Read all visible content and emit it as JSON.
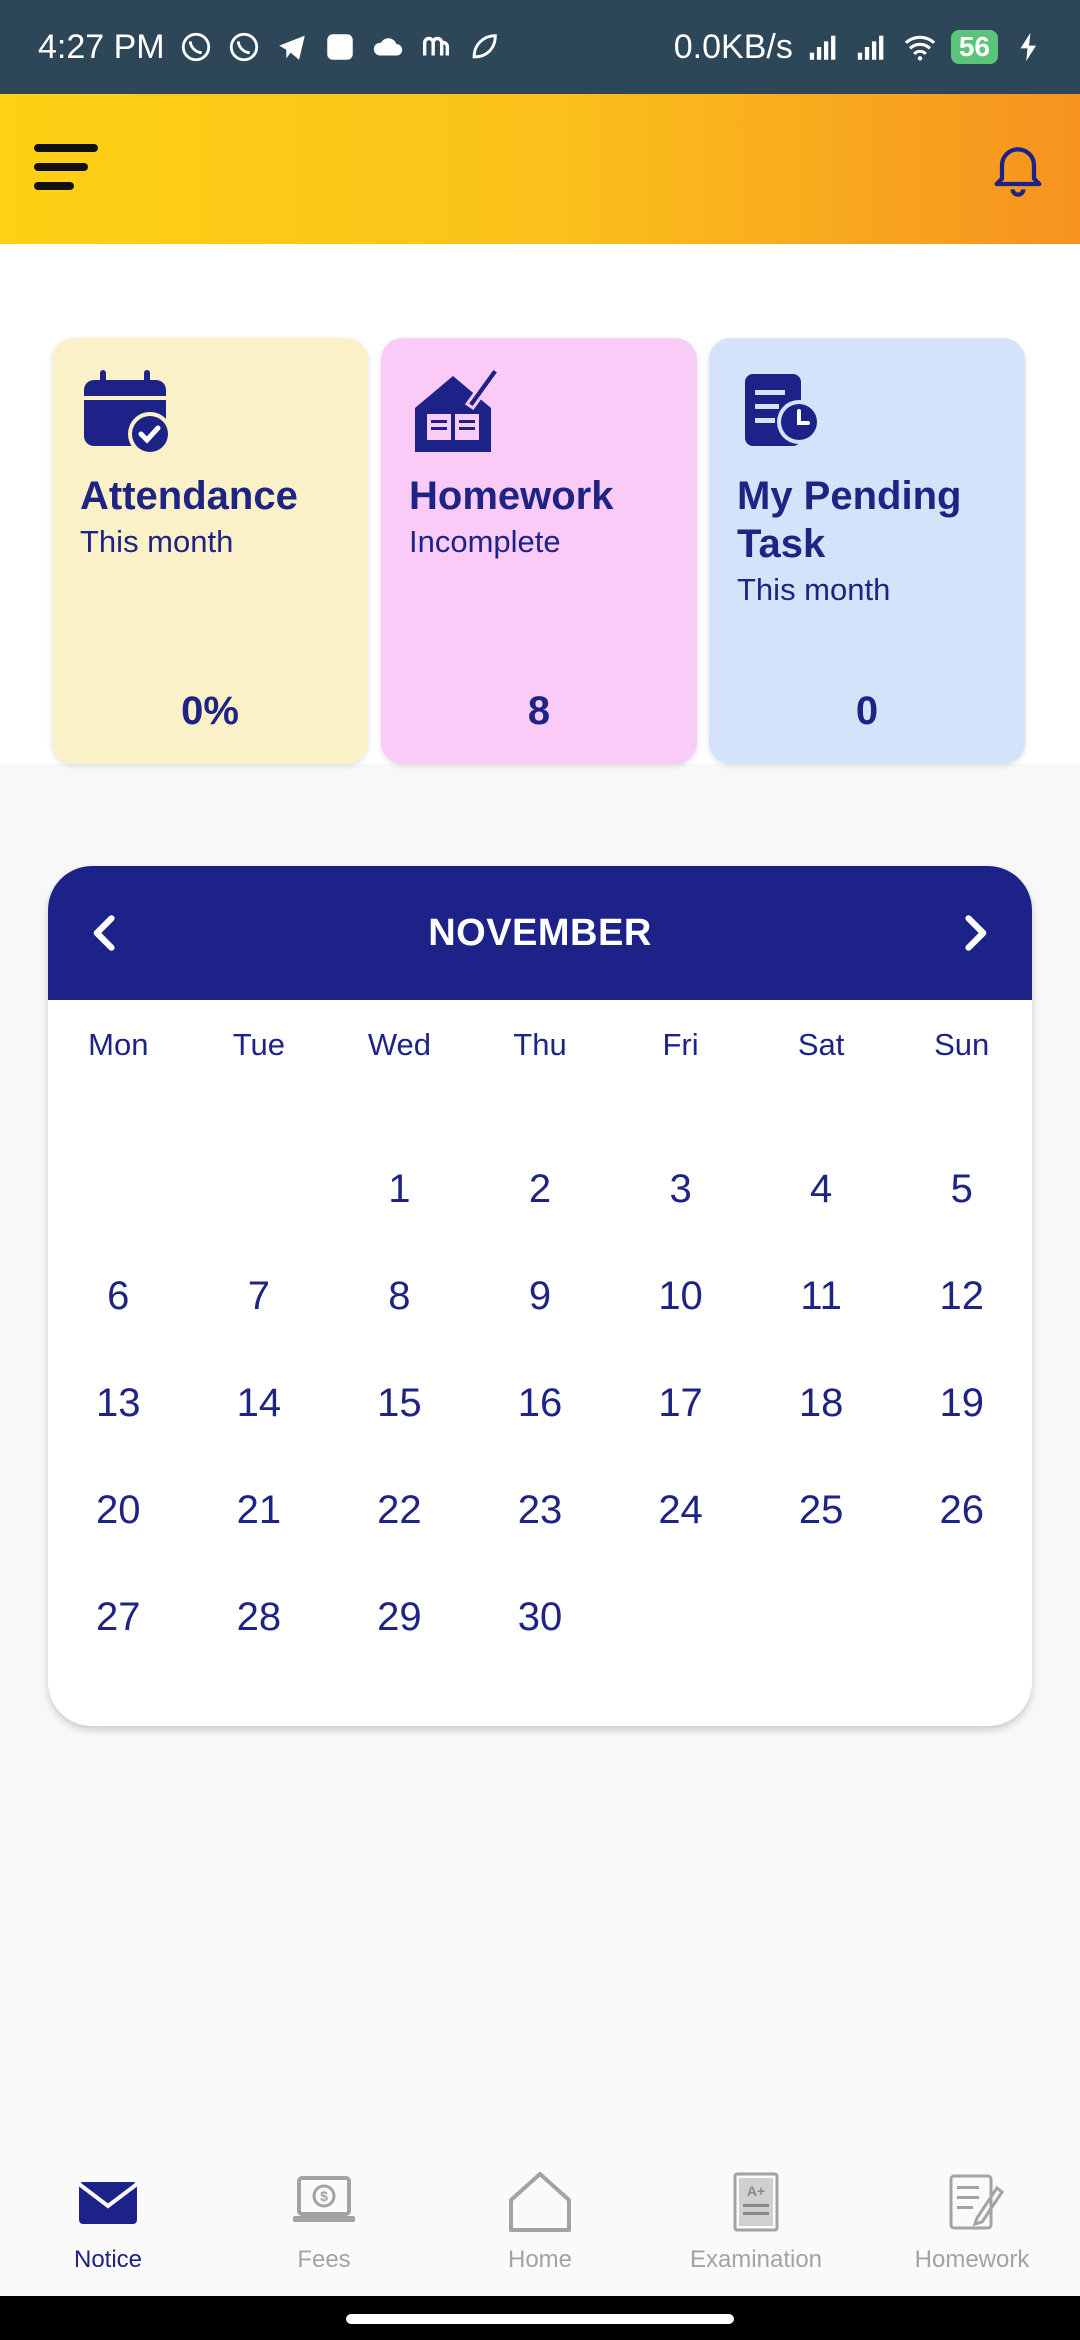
{
  "status_bar": {
    "time": "4:27 PM",
    "network_speed": "0.0KB/s",
    "battery": "56"
  },
  "cards": [
    {
      "title": "Attendance",
      "subtitle": "This month",
      "value": "0%",
      "icon": "calendar-check-icon"
    },
    {
      "title": "Homework",
      "subtitle": "Incomplete",
      "value": "8",
      "icon": "house-book-icon"
    },
    {
      "title": "My Pending Task",
      "subtitle": "This month",
      "value": "0",
      "icon": "task-clock-icon"
    }
  ],
  "calendar": {
    "month": "NOVEMBER",
    "weekdays": [
      "Mon",
      "Tue",
      "Wed",
      "Thu",
      "Fri",
      "Sat",
      "Sun"
    ],
    "days": [
      "",
      "",
      "1",
      "2",
      "3",
      "4",
      "5",
      "6",
      "7",
      "8",
      "9",
      "10",
      "11",
      "12",
      "13",
      "14",
      "15",
      "16",
      "17",
      "18",
      "19",
      "20",
      "21",
      "22",
      "23",
      "24",
      "25",
      "26",
      "27",
      "28",
      "29",
      "30",
      "",
      "",
      ""
    ]
  },
  "bottom_nav": [
    {
      "label": "Notice",
      "icon": "envelope-icon",
      "active": true
    },
    {
      "label": "Fees",
      "icon": "fees-laptop-icon",
      "active": false
    },
    {
      "label": "Home",
      "icon": "home-icon",
      "active": false
    },
    {
      "label": "Examination",
      "icon": "exam-sheet-icon",
      "active": false
    },
    {
      "label": "Homework",
      "icon": "homework-notebook-icon",
      "active": false
    }
  ],
  "colors": {
    "primary": "#1c2288",
    "header_gradient_start": "#fdd114",
    "header_gradient_end": "#f6931f",
    "attendance_card": "#fbf1c8",
    "homework_card": "#f9cbf6",
    "pending_task_card": "#d4e3fa"
  }
}
